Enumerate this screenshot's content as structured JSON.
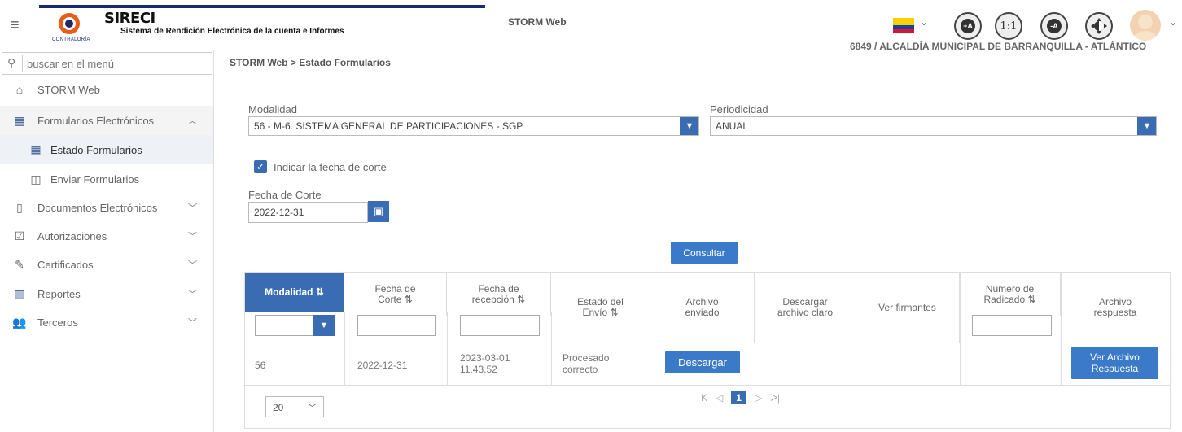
{
  "header": {
    "app_title": "STORM Web",
    "logo_name": "SIRECI",
    "logo_subtitle": "Sistema de Rendición Electrónica de la cuenta e Informes",
    "logo_caption": "CONTRALORÍA",
    "entity": "6849 / ALCALDÍA MUNICIPAL DE BARRANQUILLA - ATLÁNTICO",
    "accessibility": {
      "increase_label": "+A",
      "ratio_label": "1:1",
      "decrease_label": "-A"
    }
  },
  "sidebar": {
    "search_placeholder": "buscar en el menú",
    "items": [
      {
        "label": "STORM Web"
      },
      {
        "label": "Formularios Electrónicos"
      },
      {
        "label": "Estado Formularios"
      },
      {
        "label": "Enviar Formularios"
      },
      {
        "label": "Documentos Electrónicos"
      },
      {
        "label": "Autorizaciones"
      },
      {
        "label": "Certificados"
      },
      {
        "label": "Reportes"
      },
      {
        "label": "Terceros"
      }
    ]
  },
  "main": {
    "breadcrumb": "STORM Web > Estado Formularios",
    "modalidad_label": "Modalidad",
    "modalidad_value": "56 - M-6. SISTEMA GENERAL DE PARTICIPACIONES - SGP",
    "periodicidad_label": "Periodicidad",
    "periodicidad_value": "ANUAL",
    "checkbox_label": "Indicar la fecha de corte",
    "fecha_label": "Fecha de Corte",
    "fecha_value": "2022-12-31",
    "consultar_label": "Consultar"
  },
  "table": {
    "headers": {
      "modalidad": "Modalidad ⇅",
      "fecha_corte_1": "Fecha de",
      "fecha_corte_2": "Corte ⇅",
      "fecha_recepcion_1": "Fecha de",
      "fecha_recepcion_2": "recepción ⇅",
      "estado_1": "Estado del",
      "estado_2": "Envío ⇅",
      "archivo_enviado_1": "Archivo",
      "archivo_enviado_2": "enviado",
      "descargar_1": "Descargar",
      "descargar_2": "archivo claro",
      "firmantes": "Ver firmantes",
      "radicado_1": "Número de",
      "radicado_2": "Radicado ⇅",
      "respuesta_1": "Archivo",
      "respuesta_2": "respuesta"
    },
    "row": {
      "modalidad": "56",
      "fecha_corte": "2022-12-31",
      "fecha_recepcion_1": "2023-03-01",
      "fecha_recepcion_2": "11.43.52",
      "estado_1": "Procesado",
      "estado_2": "correcto",
      "descargar_label": "Descargar",
      "ver_archivo_1": "Ver Archivo",
      "ver_archivo_2": "Respuesta"
    },
    "pager": {
      "first": "K",
      "prev": "◁",
      "current": "1",
      "next": "▷",
      "last": "ᐳ|",
      "page_size": "20"
    }
  }
}
